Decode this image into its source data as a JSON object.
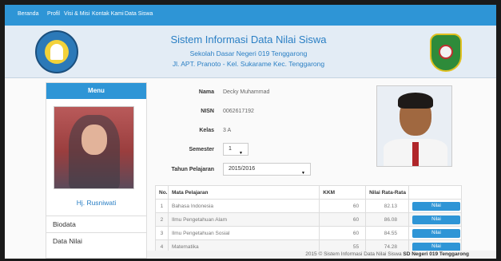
{
  "nav": {
    "items": [
      "Beranda",
      "Profil",
      "Visi & Misi",
      "Kontak Kami",
      "Data Siswa"
    ]
  },
  "header": {
    "title": "Sistem Informasi Data Nilai Siswa",
    "school": "Sekolah Dasar Negeri 019 Tenggarong",
    "address": "Jl. APT. Pranoto - Kel. Sukarame Kec. Tenggarong"
  },
  "sidebar": {
    "menu_title": "Menu",
    "teacher_name": "Hj. Rusniwati",
    "items": [
      "Biodata",
      "Data Nilai"
    ]
  },
  "student": {
    "labels": {
      "nama": "Nama",
      "nisn": "NISN",
      "kelas": "Kelas",
      "semester": "Semester",
      "tahun": "Tahun Pelajaran"
    },
    "nama": "Decky Muhammad",
    "nisn": "0062617192",
    "kelas": "3 A",
    "semester": "1",
    "tahun": "2015/2016"
  },
  "table": {
    "headers": [
      "No.",
      "Mata Pelajaran",
      "KKM",
      "Nilai Rata-Rata"
    ],
    "rows": [
      {
        "no": "1",
        "subject": "Bahasa Indonesia",
        "kkm": "60",
        "avg": "82.13",
        "button": "Nilai"
      },
      {
        "no": "2",
        "subject": "Ilmu Pengetahuan Alam",
        "kkm": "60",
        "avg": "86.08",
        "button": "Nilai"
      },
      {
        "no": "3",
        "subject": "Ilmu Pengetahuan Sosial",
        "kkm": "60",
        "avg": "84.55",
        "button": "Nilai"
      },
      {
        "no": "4",
        "subject": "Matematika",
        "kkm": "55",
        "avg": "74.28",
        "button": "Nilai"
      }
    ]
  },
  "footer": {
    "text": "2015 © Sistem Informasi Data Nilai Siswa ",
    "bold": "SD Negeri 019 Tenggarong"
  },
  "colors": {
    "accent": "#2e95d6",
    "header_bg": "#e3ecf5",
    "title_text": "#2a7fc4"
  },
  "icons": {
    "left_logo": "tut-wuri-handayani-logo",
    "right_logo": "kutai-kartanegara-logo",
    "select_caret": "caret-down-icon"
  }
}
